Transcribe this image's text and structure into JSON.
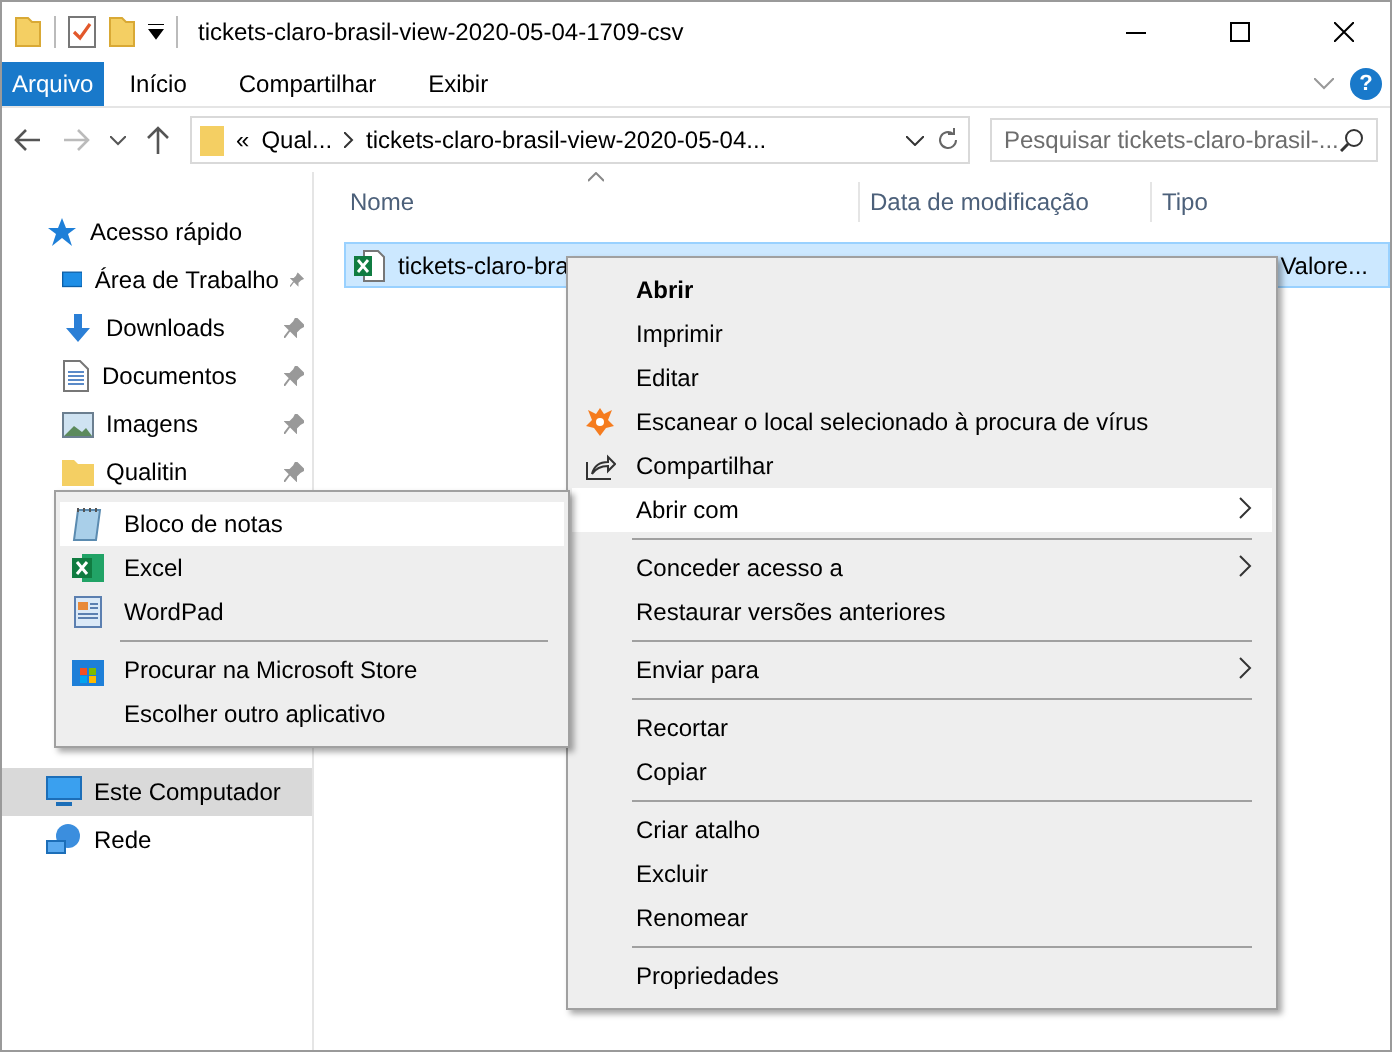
{
  "window": {
    "title": "tickets-claro-brasil-view-2020-05-04-1709-csv"
  },
  "ribbon": {
    "tabs": [
      {
        "label": "Arquivo",
        "kind": "file"
      },
      {
        "label": "Início",
        "kind": "tab"
      },
      {
        "label": "Compartilhar",
        "kind": "tab"
      },
      {
        "label": "Exibir",
        "kind": "tab"
      }
    ],
    "help": "?"
  },
  "address_bar": {
    "overflow": "«",
    "crumbs": [
      "Qual...",
      "tickets-claro-brasil-view-2020-05-04..."
    ],
    "search": {
      "placeholder": "Pesquisar tickets-claro-brasil-..."
    }
  },
  "sidebar": {
    "items": [
      {
        "label": "Acesso rápido",
        "kind": "quick",
        "selected": false,
        "pinned": false,
        "children": [
          {
            "label": "Área de Trabalho",
            "kind": "desktop",
            "selected": false,
            "pinned": true
          },
          {
            "label": "Downloads",
            "kind": "downloads",
            "selected": false,
            "pinned": true
          },
          {
            "label": "Documentos",
            "kind": "documents",
            "selected": false,
            "pinned": true
          },
          {
            "label": "Imagens",
            "kind": "pictures",
            "selected": false,
            "pinned": true
          },
          {
            "label": "Qualitin",
            "kind": "folder",
            "selected": false,
            "pinned": true
          }
        ]
      },
      {
        "label": "Este Computador",
        "kind": "computer",
        "selected": true,
        "pinned": false
      },
      {
        "label": "Rede",
        "kind": "network",
        "selected": false,
        "pinned": false
      }
    ]
  },
  "file_list": {
    "columns": [
      "Nome",
      "Data de modificação",
      "Tipo"
    ],
    "rows": [
      {
        "name": "tickets-claro-bra",
        "type": "Valore...",
        "selected": true
      }
    ]
  },
  "context_menu": {
    "items": [
      {
        "kind": "item",
        "label": "Abrir",
        "default": true,
        "submenu": false,
        "selected": false
      },
      {
        "kind": "item",
        "label": "Imprimir",
        "default": false,
        "submenu": false,
        "selected": false
      },
      {
        "kind": "item",
        "label": "Editar",
        "default": false,
        "submenu": false,
        "selected": false
      },
      {
        "kind": "scan",
        "label": "Escanear o local selecionado à procura de vírus",
        "default": false,
        "submenu": false,
        "selected": false
      },
      {
        "kind": "share",
        "label": "Compartilhar",
        "default": false,
        "submenu": false,
        "selected": false
      },
      {
        "kind": "item",
        "label": "Abrir com",
        "default": false,
        "submenu": true,
        "selected": true
      },
      {
        "kind": "separator"
      },
      {
        "kind": "item",
        "label": "Conceder acesso a",
        "default": false,
        "submenu": true,
        "selected": false
      },
      {
        "kind": "item",
        "label": "Restaurar versões anteriores",
        "default": false,
        "submenu": false,
        "selected": false
      },
      {
        "kind": "separator"
      },
      {
        "kind": "item",
        "label": "Enviar para",
        "default": false,
        "submenu": true,
        "selected": false
      },
      {
        "kind": "separator"
      },
      {
        "kind": "item",
        "label": "Recortar",
        "default": false,
        "submenu": false,
        "selected": false
      },
      {
        "kind": "item",
        "label": "Copiar",
        "default": false,
        "submenu": false,
        "selected": false
      },
      {
        "kind": "separator"
      },
      {
        "kind": "item",
        "label": "Criar atalho",
        "default": false,
        "submenu": false,
        "selected": false
      },
      {
        "kind": "item",
        "label": "Excluir",
        "default": false,
        "submenu": false,
        "selected": false
      },
      {
        "kind": "item",
        "label": "Renomear",
        "default": false,
        "submenu": false,
        "selected": false
      },
      {
        "kind": "separator"
      },
      {
        "kind": "item",
        "label": "Propriedades",
        "default": false,
        "submenu": false,
        "selected": false
      }
    ]
  },
  "open_with_menu": {
    "items": [
      {
        "kind": "notepad",
        "label": "Bloco de notas",
        "selected": true
      },
      {
        "kind": "excel",
        "label": "Excel",
        "selected": false
      },
      {
        "kind": "wordpad",
        "label": "WordPad",
        "selected": false
      },
      {
        "kind": "separator"
      },
      {
        "kind": "store",
        "label": "Procurar na Microsoft Store",
        "selected": false
      },
      {
        "kind": "item",
        "label": "Escolher outro aplicativo",
        "selected": false
      }
    ]
  }
}
